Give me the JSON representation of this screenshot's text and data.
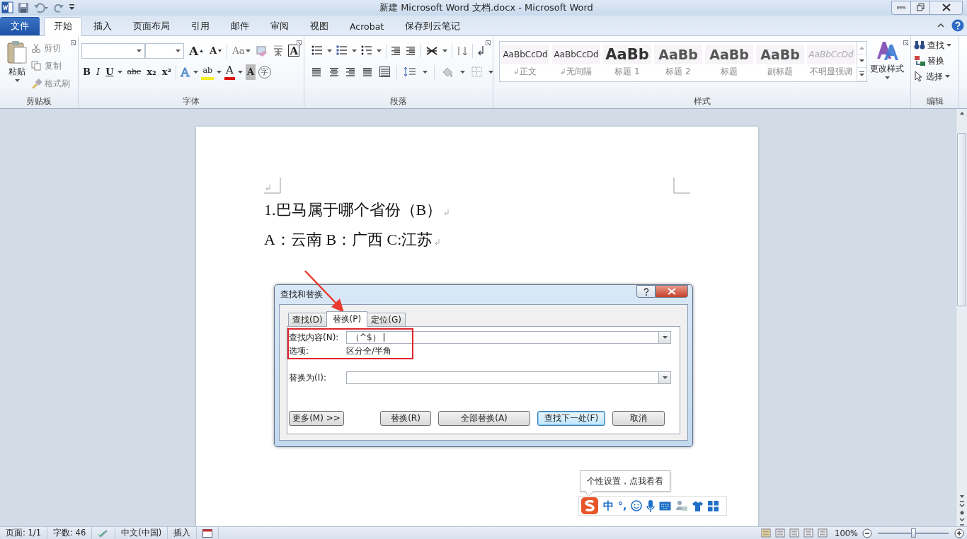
{
  "window": {
    "title": "新建 Microsoft Word 文档.docx - Microsoft Word"
  },
  "tabs": [
    {
      "label": "文件",
      "kind": "file",
      "selected": false
    },
    {
      "label": "开始",
      "kind": "tab",
      "selected": true
    },
    {
      "label": "插入",
      "kind": "tab",
      "selected": false
    },
    {
      "label": "页面布局",
      "kind": "tab",
      "selected": false
    },
    {
      "label": "引用",
      "kind": "tab",
      "selected": false
    },
    {
      "label": "邮件",
      "kind": "tab",
      "selected": false
    },
    {
      "label": "审阅",
      "kind": "tab",
      "selected": false
    },
    {
      "label": "视图",
      "kind": "tab",
      "selected": false
    },
    {
      "label": "Acrobat",
      "kind": "tab",
      "selected": false
    },
    {
      "label": "保存到云笔记",
      "kind": "tab",
      "selected": false
    }
  ],
  "ribbon": {
    "clipboard": {
      "group": "剪贴板",
      "paste": "粘贴",
      "items": [
        "剪切",
        "复制",
        "格式刷"
      ]
    },
    "font": {
      "group": "字体",
      "row1": [
        {
          "kind": "grow",
          "label": "A"
        },
        {
          "kind": "shrink",
          "label": "A"
        },
        {
          "kind": "case",
          "label": "Aa"
        },
        {
          "kind": "border",
          "label": "A"
        }
      ],
      "row2": [
        {
          "kind": "bold",
          "label": "B"
        },
        {
          "kind": "italic",
          "label": "I"
        },
        {
          "kind": "underline",
          "label": "U"
        },
        {
          "kind": "strike",
          "label": "abc"
        },
        {
          "kind": "sub",
          "label": "x₂"
        },
        {
          "kind": "sup",
          "label": "x²"
        },
        {
          "kind": "effects",
          "label": "A"
        },
        {
          "kind": "highlight",
          "label": "ab"
        },
        {
          "kind": "color",
          "label": "A"
        },
        {
          "kind": "shading",
          "label": "A"
        },
        {
          "kind": "enclose",
          "label": "字"
        }
      ]
    },
    "paragraph": {
      "group": "段落"
    },
    "styles": {
      "group": "样式",
      "change": "更改样式",
      "items": [
        {
          "sample": "AaBbCcDd",
          "name": "正文",
          "kind": "normal",
          "mark": true
        },
        {
          "sample": "AaBbCcDd",
          "name": "无间隔",
          "kind": "normal",
          "mark": true
        },
        {
          "sample": "AaBb",
          "name": "标题 1",
          "kind": "h1",
          "mark": false
        },
        {
          "sample": "AaBb",
          "name": "标题 2",
          "kind": "h2",
          "mark": false
        },
        {
          "sample": "AaBb",
          "name": "标题",
          "kind": "title",
          "mark": false
        },
        {
          "sample": "AaBb",
          "name": "副标题",
          "kind": "title",
          "mark": false
        },
        {
          "sample": "AaBbCcDd",
          "name": "不明显强调",
          "kind": "subtle",
          "mark": false
        }
      ]
    },
    "editing": {
      "group": "编辑",
      "items": [
        {
          "label": "查找",
          "kind": "find"
        },
        {
          "label": "替换",
          "kind": "replace"
        },
        {
          "label": "选择",
          "kind": "select"
        }
      ]
    }
  },
  "document": {
    "paragraphs": [
      "1.巴马属于哪个省份（B）",
      "A：云南 B：广西 C:江苏"
    ]
  },
  "dialog": {
    "title": "查找和替换",
    "tabs": [
      {
        "label": "查找(D)",
        "selected": false
      },
      {
        "label": "替换(P)",
        "selected": true
      },
      {
        "label": "定位(G)",
        "selected": false
      }
    ],
    "find_label": "查找内容(N):",
    "find_value": "（^$）",
    "options_label": "选项:",
    "options_value": "区分全/半角",
    "replace_label": "替换为(I):",
    "buttons": [
      {
        "label": "更多(M) >>",
        "default": false
      },
      {
        "label": "替换(R)",
        "default": false
      },
      {
        "label": "全部替换(A)",
        "default": false
      },
      {
        "label": "查找下一处(F)",
        "default": true
      },
      {
        "label": "取消",
        "default": false
      }
    ]
  },
  "tooltip": "个性设置，点我看看",
  "ime": {
    "mode": "中",
    "punctuation": "°,"
  },
  "status_bar": {
    "page": "页面: 1/1",
    "words": "字数: 46",
    "language": "中文(中国)",
    "mode": "插入",
    "zoom": "100%",
    "zoom_slider": {
      "level": 0.5
    }
  }
}
